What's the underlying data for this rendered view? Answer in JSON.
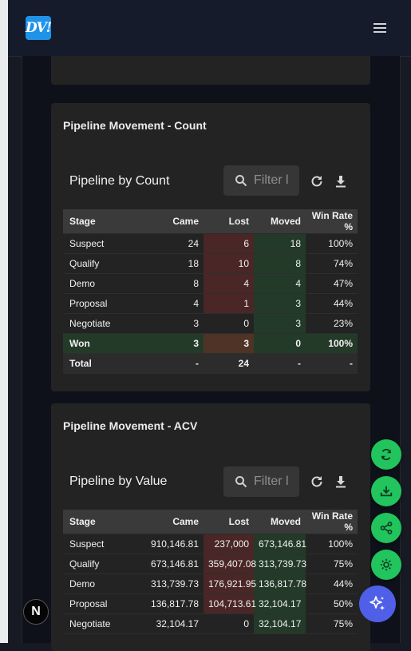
{
  "header": {
    "logo_text": "DV!",
    "menu_icon": "hamburger-icon"
  },
  "count_card": {
    "title": "Pipeline Movement - Count",
    "panel_title": "Pipeline by Count",
    "filter_placeholder": "Filter l",
    "columns": [
      "Stage",
      "Came",
      "Lost",
      "Moved",
      "Win Rate %"
    ],
    "rows": [
      [
        "Suspect",
        "24",
        "6",
        "18",
        "100%"
      ],
      [
        "Qualify",
        "18",
        "10",
        "8",
        "74%"
      ],
      [
        "Demo",
        "8",
        "4",
        "4",
        "47%"
      ],
      [
        "Proposal",
        "4",
        "1",
        "3",
        "44%"
      ],
      [
        "Negotiate",
        "3",
        "0",
        "3",
        "23%"
      ],
      [
        "Won",
        "3",
        "3",
        "0",
        "100%"
      ],
      [
        "Total",
        "-",
        "24",
        "-",
        "-"
      ]
    ]
  },
  "acv_card": {
    "title": "Pipeline Movement - ACV",
    "panel_title": "Pipeline by Value",
    "filter_placeholder": "Filter l",
    "columns": [
      "Stage",
      "Came",
      "Lost",
      "Moved",
      "Win Rate %"
    ],
    "rows": [
      [
        "Suspect",
        "910,146.81",
        "237,000",
        "673,146.81",
        "100%"
      ],
      [
        "Qualify",
        "673,146.81",
        "359,407.08",
        "313,739.73",
        "75%"
      ],
      [
        "Demo",
        "313,739.73",
        "176,921.95",
        "136,817.78",
        "44%"
      ],
      [
        "Proposal",
        "136,817.78",
        "104,713.61",
        "32,104.17",
        "50%"
      ],
      [
        "Negotiate",
        "32,104.17",
        "0",
        "32,104.17",
        "75%"
      ]
    ]
  },
  "fabs": [
    "refresh-icon",
    "download-icon",
    "share-icon",
    "sun-icon",
    "sparkles-icon"
  ],
  "badge_text": "N"
}
